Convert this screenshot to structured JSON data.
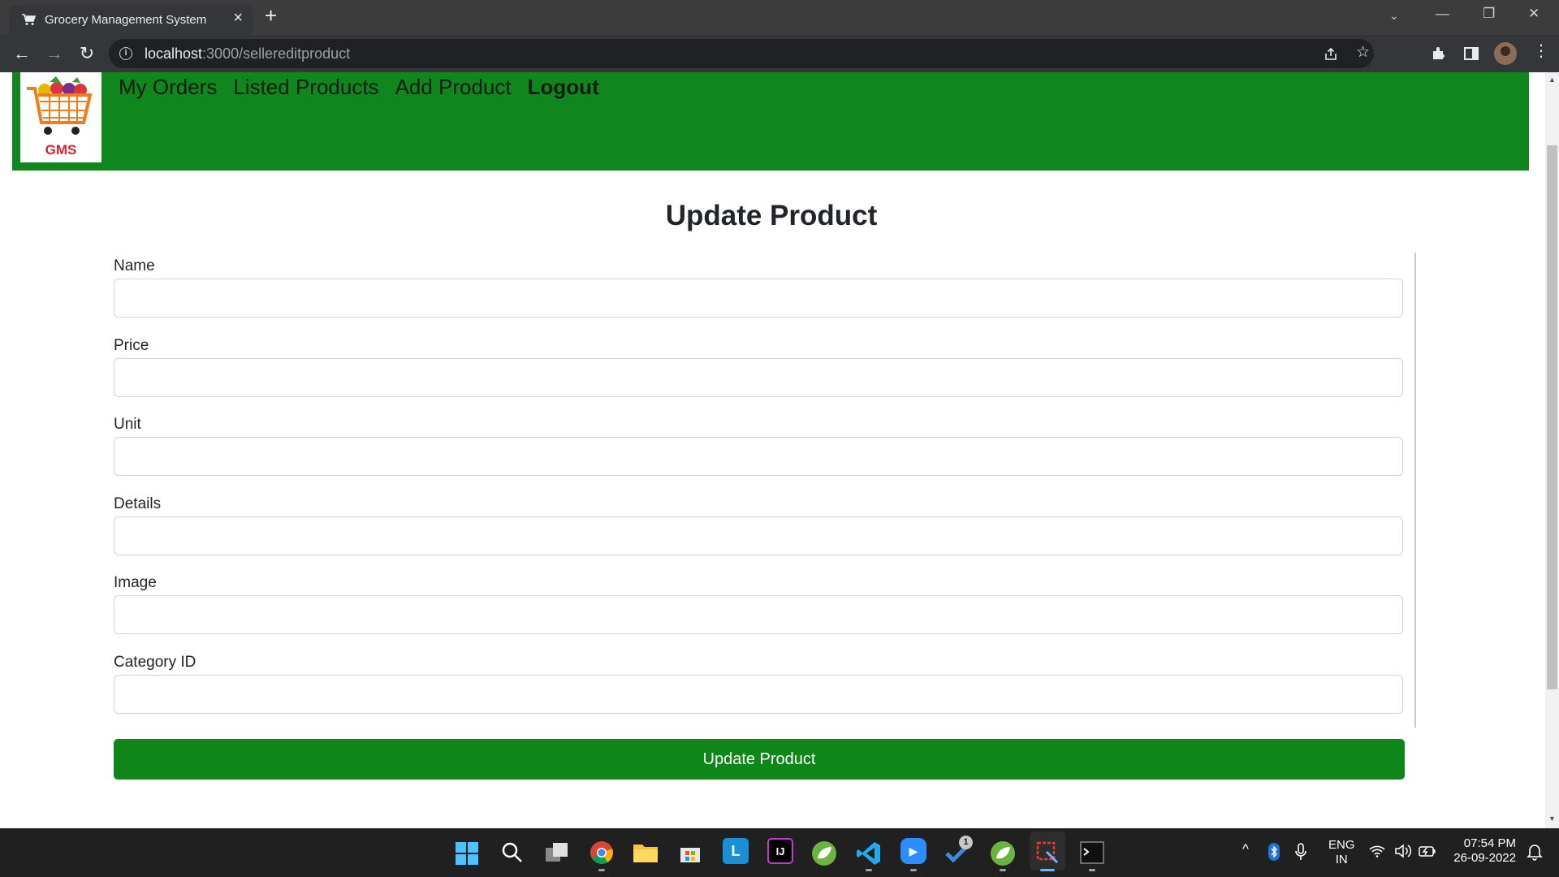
{
  "browser": {
    "tab_title": "Grocery Management System",
    "url_host": "localhost",
    "url_rest": ":3000/sellereditproduct"
  },
  "navbar": {
    "logo_text": "GMS",
    "links": [
      {
        "label": "My Orders",
        "bold": false
      },
      {
        "label": "Listed Products",
        "bold": false
      },
      {
        "label": "Add Product",
        "bold": false
      },
      {
        "label": "Logout",
        "bold": true
      }
    ]
  },
  "form": {
    "title": "Update Product",
    "fields": [
      {
        "label": "Name",
        "value": ""
      },
      {
        "label": "Price",
        "value": ""
      },
      {
        "label": "Unit",
        "value": ""
      },
      {
        "label": "Details",
        "value": ""
      },
      {
        "label": "Image",
        "value": ""
      },
      {
        "label": "Category ID",
        "value": ""
      }
    ],
    "submit_label": "Update Product"
  },
  "taskbar": {
    "language_line1": "ENG",
    "language_line2": "IN",
    "time": "07:54 PM",
    "date": "26-09-2022",
    "badge_count": "1"
  },
  "colors": {
    "navbar_green": "#12861e",
    "button_green": "#0f861a",
    "chrome_dark": "#35363a"
  }
}
